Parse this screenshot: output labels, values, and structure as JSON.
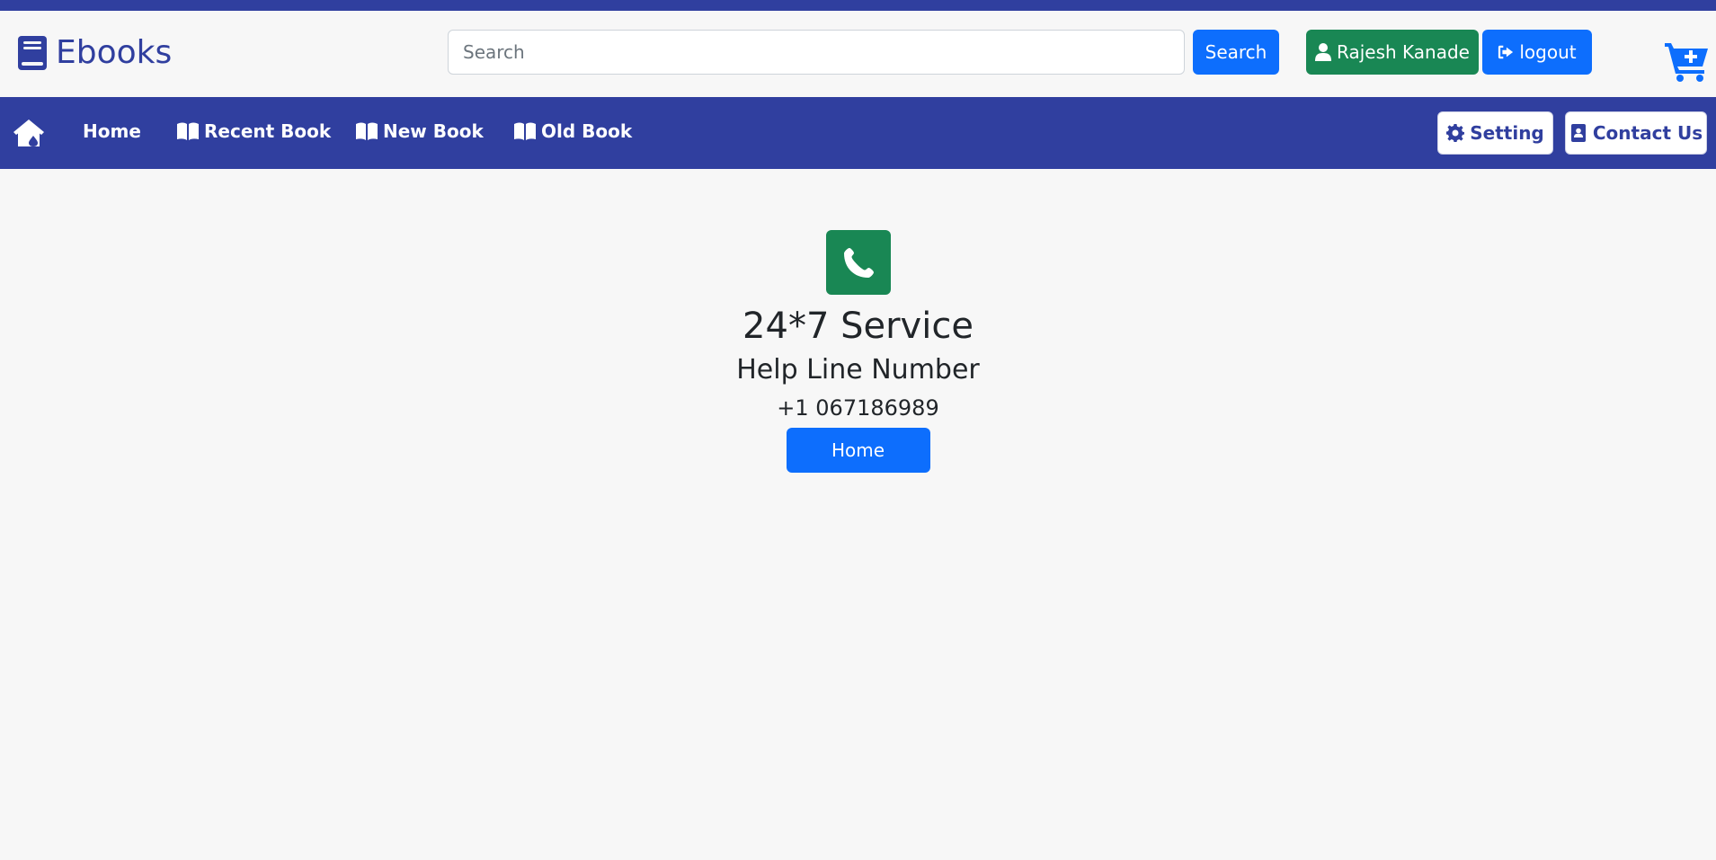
{
  "header": {
    "brand_label": "Ebooks",
    "search": {
      "placeholder": "Search",
      "value": "",
      "button_label": "Search"
    },
    "user_button_label": "Rajesh Kanade",
    "logout_button_label": "logout"
  },
  "navbar": {
    "links": [
      {
        "label": "Home"
      },
      {
        "label": "Recent Book"
      },
      {
        "label": "New Book"
      },
      {
        "label": "Old Book"
      }
    ],
    "setting_label": "Setting",
    "contact_label": "Contact Us"
  },
  "main": {
    "title": "24*7 Service",
    "subtitle": "Help Line Number",
    "phone_number": "+1 067186989",
    "home_button_label": "Home"
  },
  "colors": {
    "brand": "#303f9f",
    "primary": "#0d6efd",
    "success": "#198754",
    "background": "#f7f7f7"
  },
  "icons": {
    "brand": "book-icon",
    "user": "user-icon",
    "logout": "logout-icon",
    "cart": "cart-plus-icon",
    "nav_home": "house-icon",
    "nav_books": "open-book-icon",
    "setting": "gear-icon",
    "contact": "contact-book-icon",
    "service": "phone-icon"
  }
}
